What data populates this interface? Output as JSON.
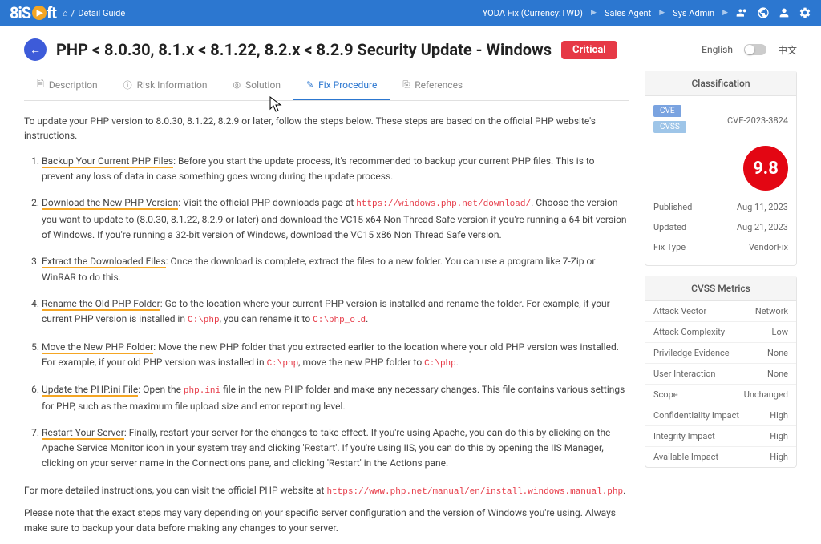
{
  "header": {
    "logo": "8iS",
    "logo_suffix": "ft",
    "breadcrumb_home": "⌂",
    "breadcrumb_sep": "/",
    "breadcrumb_page": "Detail Guide",
    "nav1": "YODA Fix (Currency:TWD)",
    "nav2": "Sales Agent",
    "nav3": "Sys Admin"
  },
  "title": {
    "heading": "PHP < 8.0.30, 8.1.x < 8.1.22, 8.2.x < 8.2.9 Security Update - Windows",
    "severity": "Critical",
    "lang_en": "English",
    "lang_cn": "中文"
  },
  "tabs": {
    "t0": "Description",
    "t1": "Risk Information",
    "t2": "Solution",
    "t3": "Fix Procedure",
    "t4": "References"
  },
  "body": {
    "intro": "To update your PHP version to 8.0.30, 8.1.22, 8.2.9 or later, follow the steps below. These steps are based on the official PHP website's instructions.",
    "s1_label": "Backup Your Current PHP Files",
    "s1_text": ": Before you start the update process, it's recommended to backup your current PHP files. This is to prevent any loss of data in case something goes wrong during the update process.",
    "s2_label": "Download the New PHP Version",
    "s2_text1": ": Visit the official PHP downloads page at ",
    "s2_link": "https://windows.php.net/download/",
    "s2_text2": ". Choose the version you want to update to (8.0.30, 8.1.22, 8.2.9 or later) and download the VC15 x64 Non Thread Safe version if you're running a 64-bit version of Windows. If you're running a 32-bit version of Windows, download the VC15 x86 Non Thread Safe version.",
    "s3_label": "Extract the Downloaded Files",
    "s3_text": ": Once the download is complete, extract the files to a new folder. You can use a program like 7-Zip or WinRAR to do this.",
    "s4_label": "Rename the Old PHP Folder",
    "s4_text1": ": Go to the location where your current PHP version is installed and rename the folder. For example, if your current PHP version is installed in ",
    "s4_code1": "C:\\php",
    "s4_text2": ", you can rename it to ",
    "s4_code2": "C:\\php_old",
    "s4_text3": ".",
    "s5_label": "Move the New PHP Folder",
    "s5_text1": ": Move the new PHP folder that you extracted earlier to the location where your old PHP version was installed. For example, if your old PHP version was installed in ",
    "s5_code1": "C:\\php",
    "s5_text2": ", move the new PHP folder to ",
    "s5_code2": "C:\\php",
    "s5_text3": ".",
    "s6_label": "Update the PHP.ini File",
    "s6_text1": ": Open the ",
    "s6_code1": "php.ini",
    "s6_text2": " file in the new PHP folder and make any necessary changes. This file contains various settings for PHP, such as the maximum file upload size and error reporting level.",
    "s7_label": "Restart Your Server",
    "s7_text": ": Finally, restart your server for the changes to take effect. If you're using Apache, you can do this by clicking on the Apache Service Monitor icon in your system tray and clicking 'Restart'. If you're using IIS, you can do this by opening the IIS Manager, clicking on your server name in the Connections pane, and clicking 'Restart' in the Actions pane.",
    "more_text": "For more detailed instructions, you can visit the official PHP website at ",
    "more_link": "https://www.php.net/manual/en/install.windows.manual.php",
    "note": "Please note that the exact steps may vary depending on your specific server configuration and the version of Windows you're using. Always make sure to backup your data before making any changes to your server."
  },
  "classification": {
    "header": "Classification",
    "cve_tag": "CVE",
    "cvss_tag": "CVSS",
    "cve_id": "CVE-2023-3824",
    "score": "9.8",
    "published_label": "Published",
    "published_val": "Aug 11, 2023",
    "updated_label": "Updated",
    "updated_val": "Aug 21, 2023",
    "fixtype_label": "Fix Type",
    "fixtype_val": "VendorFix"
  },
  "cvss": {
    "header": "CVSS Metrics",
    "m0_l": "Attack Vector",
    "m0_v": "Network",
    "m1_l": "Attack Complexity",
    "m1_v": "Low",
    "m2_l": "Priviledge Evidence",
    "m2_v": "None",
    "m3_l": "User Interaction",
    "m3_v": "None",
    "m4_l": "Scope",
    "m4_v": "Unchanged",
    "m5_l": "Confidentiality Impact",
    "m5_v": "High",
    "m6_l": "Integrity Impact",
    "m6_v": "High",
    "m7_l": "Available Impact",
    "m7_v": "High"
  }
}
